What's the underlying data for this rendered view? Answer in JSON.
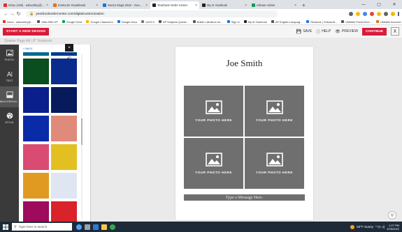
{
  "browser": {
    "tabs": [
      {
        "label": "Inbox (159) - asbuckley@nbctnn",
        "color": "#d93025",
        "active": false
      },
      {
        "label": "Instructor Gradebook",
        "color": "#e8710a",
        "active": false
      },
      {
        "label": "Senior Mugs 2022 - Google Docs",
        "color": "#1a73e8",
        "active": false
      },
      {
        "label": "Yearbook Order Center",
        "color": "#222222",
        "active": true
      },
      {
        "label": "My AI Yearbook",
        "color": "#222222",
        "active": false
      },
      {
        "label": "eShare Admin",
        "color": "#0f9d58",
        "active": false
      }
    ],
    "new_tab": "+",
    "url": "yearbookordercenter.com/digitalcustomization",
    "bookmarks": [
      {
        "label": "Inbox - asbuckley@...",
        "color": "#d93025"
      },
      {
        "label": "Miss Effie HP",
        "color": "#555555"
      },
      {
        "label": "Google Drive",
        "color": "#0f9d58"
      },
      {
        "label": "Google Classroom",
        "color": "#f4b400"
      },
      {
        "label": "Google Docs",
        "color": "#1a73e8"
      },
      {
        "label": "UNTLS",
        "color": "#777777"
      },
      {
        "label": "AP Subjects Questi...",
        "color": "#555555"
      },
      {
        "label": "British Literature au...",
        "color": "#555555"
      },
      {
        "label": "Sign In",
        "color": "#1a73e8"
      },
      {
        "label": "My AI Yearbook",
        "color": "#222222"
      },
      {
        "label": "AP English Languag...",
        "color": "#555555"
      },
      {
        "label": "Rewards | Onboardi...",
        "color": "#1a73e8"
      },
      {
        "label": "UMiddle Portal Scre...",
        "color": "#555555"
      },
      {
        "label": "UMiddle Account...",
        "color": "#e8710a"
      }
    ]
  },
  "app": {
    "start_label": "START A NEW DESIGN",
    "subtitle": "Quarter Page Ad | 8\" Yearbook",
    "save_label": "SAVE",
    "help_label": "HELP",
    "preview_label": "PREVIEW",
    "continue_label": "CONTINUE",
    "close_label": "X"
  },
  "rail": {
    "items": [
      {
        "label": "PHOTO",
        "icon": "image-icon",
        "active": false
      },
      {
        "label": "TEXT",
        "icon": "text-icon",
        "active": false
      },
      {
        "label": "BACKGROUN...",
        "icon": "background-icon",
        "active": true
      },
      {
        "label": "STYLE",
        "icon": "palette-icon",
        "active": false
      }
    ]
  },
  "panel": {
    "back_label": "< BACK",
    "close_label": "×",
    "undo_label": "↶",
    "swatches": [
      [
        "#006b8f",
        "#003b8e"
      ],
      [
        "#0a4d1e",
        "#0a2b8c"
      ],
      [
        "#0a1f8c",
        "#061a5c"
      ],
      [
        "#0a2ba8",
        "#e08a7a"
      ],
      [
        "#d94b73",
        "#e3c022"
      ],
      [
        "#e09a22",
        "#dfe6f2"
      ],
      [
        "#9e0a5c",
        "#d9222a"
      ]
    ]
  },
  "canvas": {
    "name": "Joe Smith",
    "photos": [
      {
        "label": "YOUR PHOTO HERE"
      },
      {
        "label": "YOUR PHOTO HERE"
      },
      {
        "label": "YOUR PHOTO HERE"
      },
      {
        "label": "YOUR PHOTO HERE"
      }
    ],
    "message": "Type a Message Here."
  },
  "taskbar": {
    "search_placeholder": "Type here to search",
    "weather": "63°F Sunny",
    "time": "1:27 PM",
    "date": "2/25/2022"
  }
}
